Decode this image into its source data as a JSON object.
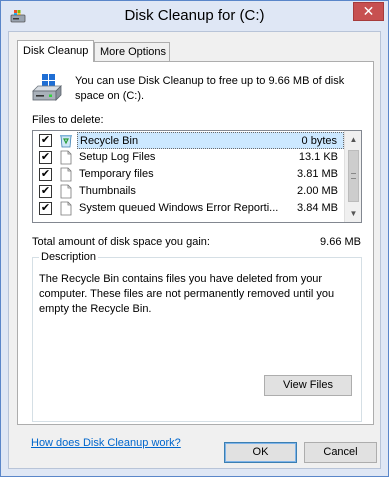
{
  "window": {
    "title": "Disk Cleanup for  (C:)",
    "close_glyph": "✕",
    "app_icon": "disk-cleanup-icon"
  },
  "tabs": [
    {
      "label": "Disk Cleanup",
      "active": true
    },
    {
      "label": "More Options",
      "active": false
    }
  ],
  "intro": {
    "icon": "drive-icon",
    "text": "You can use Disk Cleanup to free up to 9.66 MB of disk space on  (C:)."
  },
  "files_to_delete": {
    "label": "Files to delete:",
    "items": [
      {
        "name": "Recycle Bin",
        "size": "0 bytes",
        "checked": true,
        "selected": true,
        "icon": "recycle-bin-icon"
      },
      {
        "name": "Setup Log Files",
        "size": "13.1 KB",
        "checked": true,
        "selected": false,
        "icon": "file-icon"
      },
      {
        "name": "Temporary files",
        "size": "3.81 MB",
        "checked": true,
        "selected": false,
        "icon": "file-icon"
      },
      {
        "name": "Thumbnails",
        "size": "2.00 MB",
        "checked": true,
        "selected": false,
        "icon": "file-icon"
      },
      {
        "name": "System queued Windows Error Reporti...",
        "size": "3.84 MB",
        "checked": true,
        "selected": false,
        "icon": "file-icon"
      }
    ],
    "check_glyph": "✔"
  },
  "total": {
    "label": "Total amount of disk space you gain:",
    "value": "9.66 MB"
  },
  "description": {
    "legend": "Description",
    "text": "The Recycle Bin contains files you have deleted from your computer. These files are not permanently removed until you empty the Recycle Bin.",
    "view_files_label": "View Files"
  },
  "help_link": "How does Disk Cleanup work?",
  "buttons": {
    "ok_label": "OK",
    "cancel_label": "Cancel"
  }
}
